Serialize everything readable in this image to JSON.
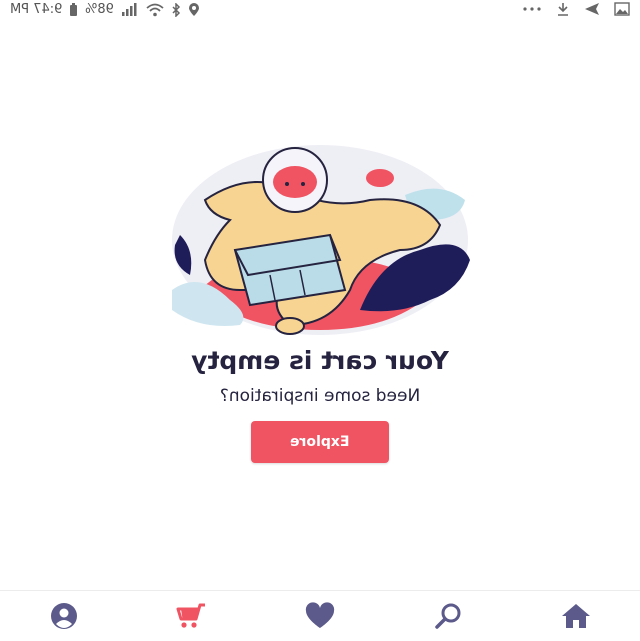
{
  "status_bar": {
    "time": "9:47 PM",
    "battery": "98%",
    "icons": [
      "location-icon",
      "bluetooth-icon",
      "wifi-icon",
      "signal-icon",
      "battery-icon",
      "more-dots-icon",
      "download-icon",
      "send-icon",
      "image-icon"
    ]
  },
  "empty_cart": {
    "title": "Your cart is empty",
    "subtitle": "Need some inspiration?",
    "button_label": "Explore"
  },
  "bottom_nav": {
    "items": [
      {
        "id": "profile",
        "icon": "profile-icon"
      },
      {
        "id": "cart",
        "icon": "cart-icon",
        "active": true
      },
      {
        "id": "favorites",
        "icon": "heart-icon"
      },
      {
        "id": "search",
        "icon": "search-icon"
      },
      {
        "id": "home",
        "icon": "home-icon"
      }
    ]
  },
  "colors": {
    "accent": "#f05463",
    "nav_icon": "#5b5a8a",
    "text": "#25233f"
  }
}
